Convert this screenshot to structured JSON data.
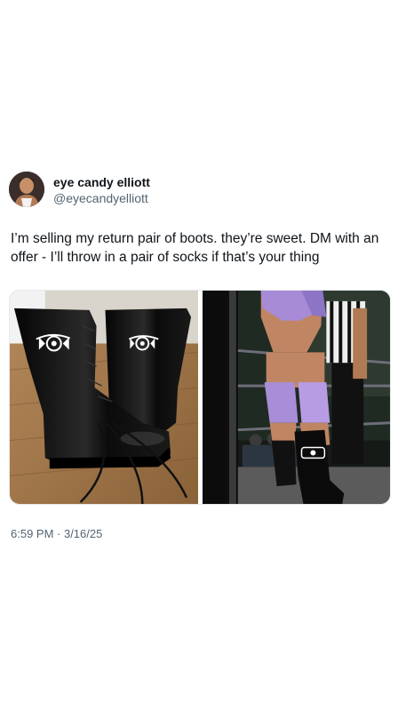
{
  "tweet": {
    "author": {
      "display_name": "eye candy elliott",
      "handle": "@eyecandyelliott"
    },
    "text": "I’m selling my return pair of boots. they’re sweet. DM with an offer - I’ll throw in a pair of socks if that’s your thing",
    "media": [
      {
        "icon": "boots-photo"
      },
      {
        "icon": "wrestling-ring-photo"
      }
    ],
    "timestamp": "6:59 PM · 3/16/25"
  }
}
